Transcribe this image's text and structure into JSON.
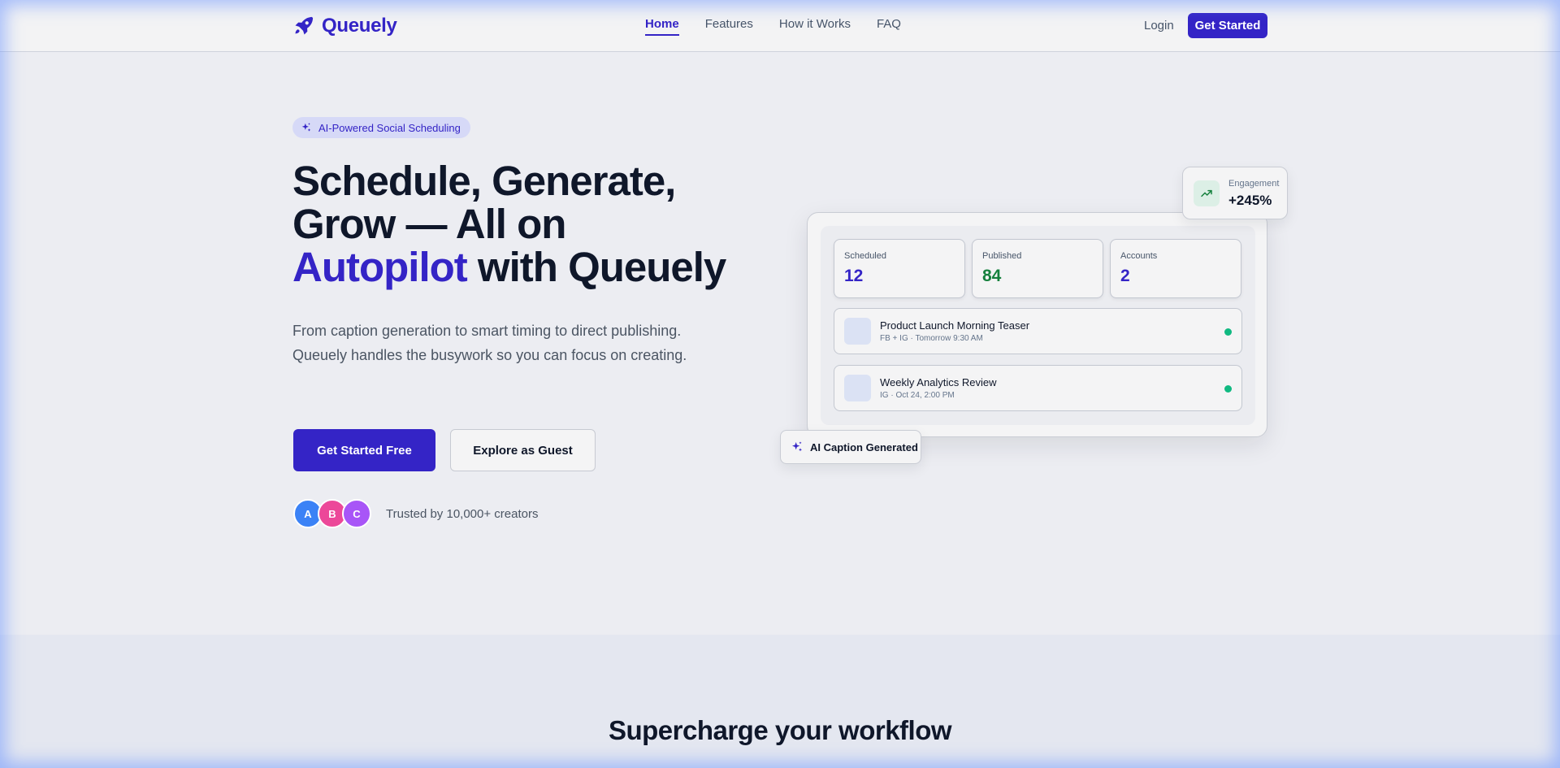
{
  "brand": {
    "name": "Queuely",
    "color": "#3424c6"
  },
  "nav": {
    "links": [
      {
        "label": "Home",
        "active": true
      },
      {
        "label": "Features",
        "active": false
      },
      {
        "label": "How it Works",
        "active": false
      },
      {
        "label": "FAQ",
        "active": false
      }
    ],
    "login": "Login",
    "cta": "Get Started"
  },
  "hero": {
    "badge": "AI-Powered Social Scheduling",
    "headline_part1": "Schedule, Generate, Grow — All on ",
    "headline_accent": "Autopilot",
    "headline_part2": " with Queuely",
    "subtext": "From caption generation to smart timing to direct publishing. Queuely handles the busywork so you can focus on creating.",
    "primary_button": "Get Started Free",
    "secondary_button": "Explore as Guest",
    "avatars": [
      "A",
      "B",
      "C"
    ],
    "trust_text": "Trusted by 10,000+ creators"
  },
  "dashboard": {
    "stats": [
      {
        "label": "Scheduled",
        "value": "12",
        "color": "#3424c6"
      },
      {
        "label": "Published",
        "value": "84",
        "color": "#15803d"
      },
      {
        "label": "Accounts",
        "value": "2",
        "color": "#3424c6"
      }
    ],
    "posts": [
      {
        "title": "Product Launch Morning Teaser",
        "meta": "FB + IG · Tomorrow 9:30 AM"
      },
      {
        "title": "Weekly Analytics Review",
        "meta": "IG · Oct 24, 2:00 PM"
      }
    ],
    "engagement": {
      "label": "Engagement",
      "value": "+245%"
    },
    "caption_chip": "AI Caption Generated"
  },
  "section2": {
    "title": "Supercharge your workflow"
  }
}
